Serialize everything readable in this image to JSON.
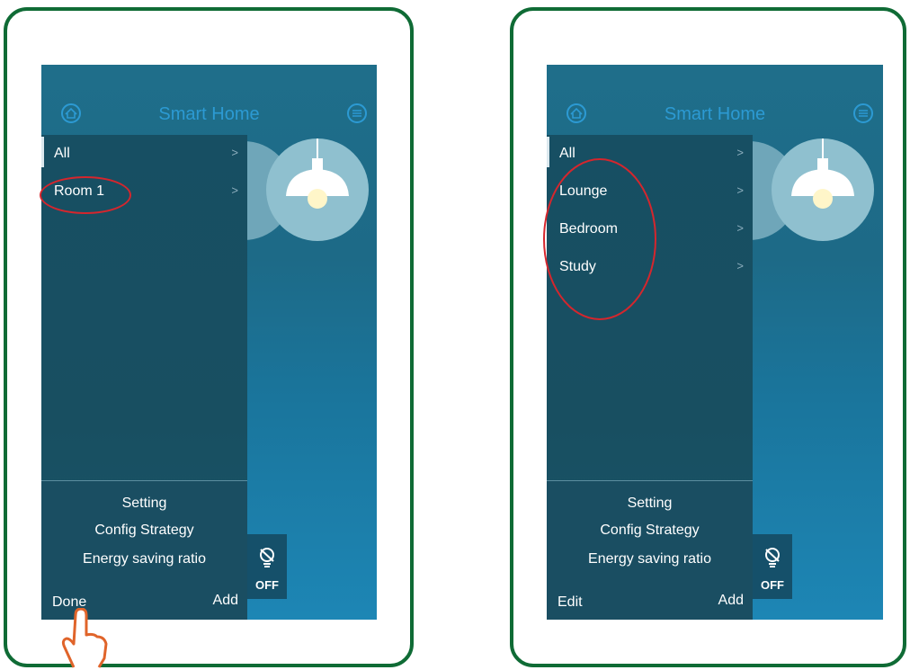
{
  "left_screen": {
    "title": "Smart Home",
    "menu_items": [
      {
        "label": "All",
        "chevron": ">"
      },
      {
        "label": "Room 1",
        "chevron": ">"
      }
    ],
    "footer": {
      "setting": "Setting",
      "config": "Config Strategy",
      "energy": "Energy saving ratio",
      "left_action": "Done",
      "right_action": "Add"
    },
    "switch_state": "OFF"
  },
  "right_screen": {
    "title": "Smart Home",
    "menu_items": [
      {
        "label": "All",
        "chevron": ">"
      },
      {
        "label": "Lounge",
        "chevron": ">"
      },
      {
        "label": "Bedroom",
        "chevron": ">"
      },
      {
        "label": "Study",
        "chevron": ">"
      }
    ],
    "footer": {
      "setting": "Setting",
      "config": "Config Strategy",
      "energy": "Energy saving ratio",
      "left_action": "Edit",
      "right_action": "Add"
    },
    "switch_state": "OFF"
  },
  "colors": {
    "frame": "#0f6b35",
    "annotation": "#d5262d",
    "title": "#2c9ad3",
    "hand": "#e0642a"
  },
  "icons": [
    "home-icon",
    "menu-icon",
    "pendant-lamp-icon",
    "bulb-off-icon",
    "pointing-hand-icon"
  ]
}
